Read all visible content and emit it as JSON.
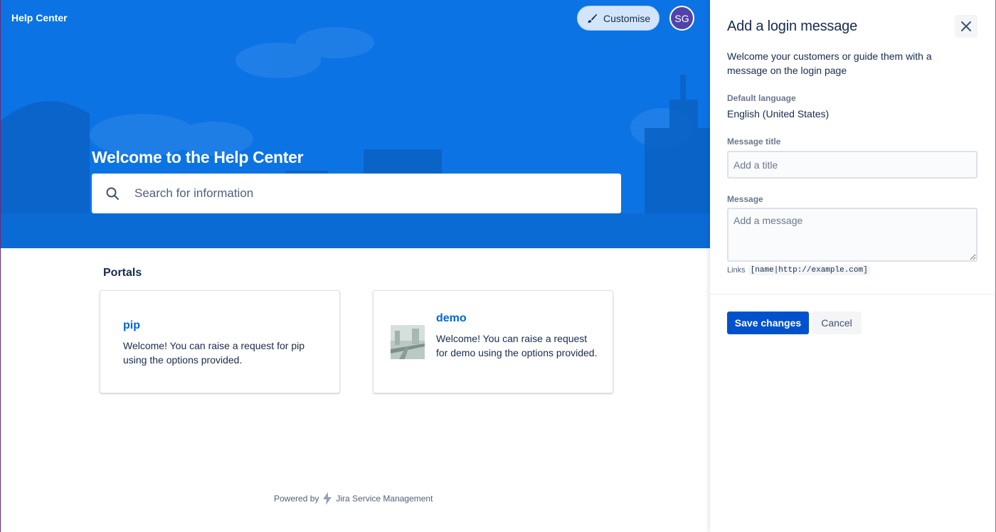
{
  "header": {
    "brand": "Help Center",
    "customise_label": "Customise",
    "avatar_initials": "SG"
  },
  "hero": {
    "title": "Welcome to the Help Center",
    "search_placeholder": "Search for information"
  },
  "portals": {
    "heading": "Portals",
    "items": [
      {
        "name": "pip",
        "description": "Welcome! You can raise a request for pip using the options provided."
      },
      {
        "name": "demo",
        "description": "Welcome! You can raise a request for demo using the options provided."
      }
    ]
  },
  "footer": {
    "powered_by": "Powered by",
    "product": "Jira Service Management"
  },
  "drawer": {
    "title": "Add a login message",
    "intro": "Welcome your customers or guide them with a message on the login page",
    "default_language_label": "Default language",
    "default_language_value": "English (United States)",
    "message_title_label": "Message title",
    "message_title_placeholder": "Add a title",
    "message_label": "Message",
    "message_placeholder": "Add a message",
    "links_label": "Links",
    "links_syntax": "[name|http://example.com]",
    "save_label": "Save changes",
    "cancel_label": "Cancel"
  },
  "colors": {
    "hero_blue": "#0c73e4",
    "primary_button": "#0052cc",
    "link": "#0065d8",
    "avatar": "#5243aa"
  },
  "icons": [
    "paintbrush-icon",
    "search-icon",
    "close-icon",
    "jira-lightning-icon"
  ]
}
